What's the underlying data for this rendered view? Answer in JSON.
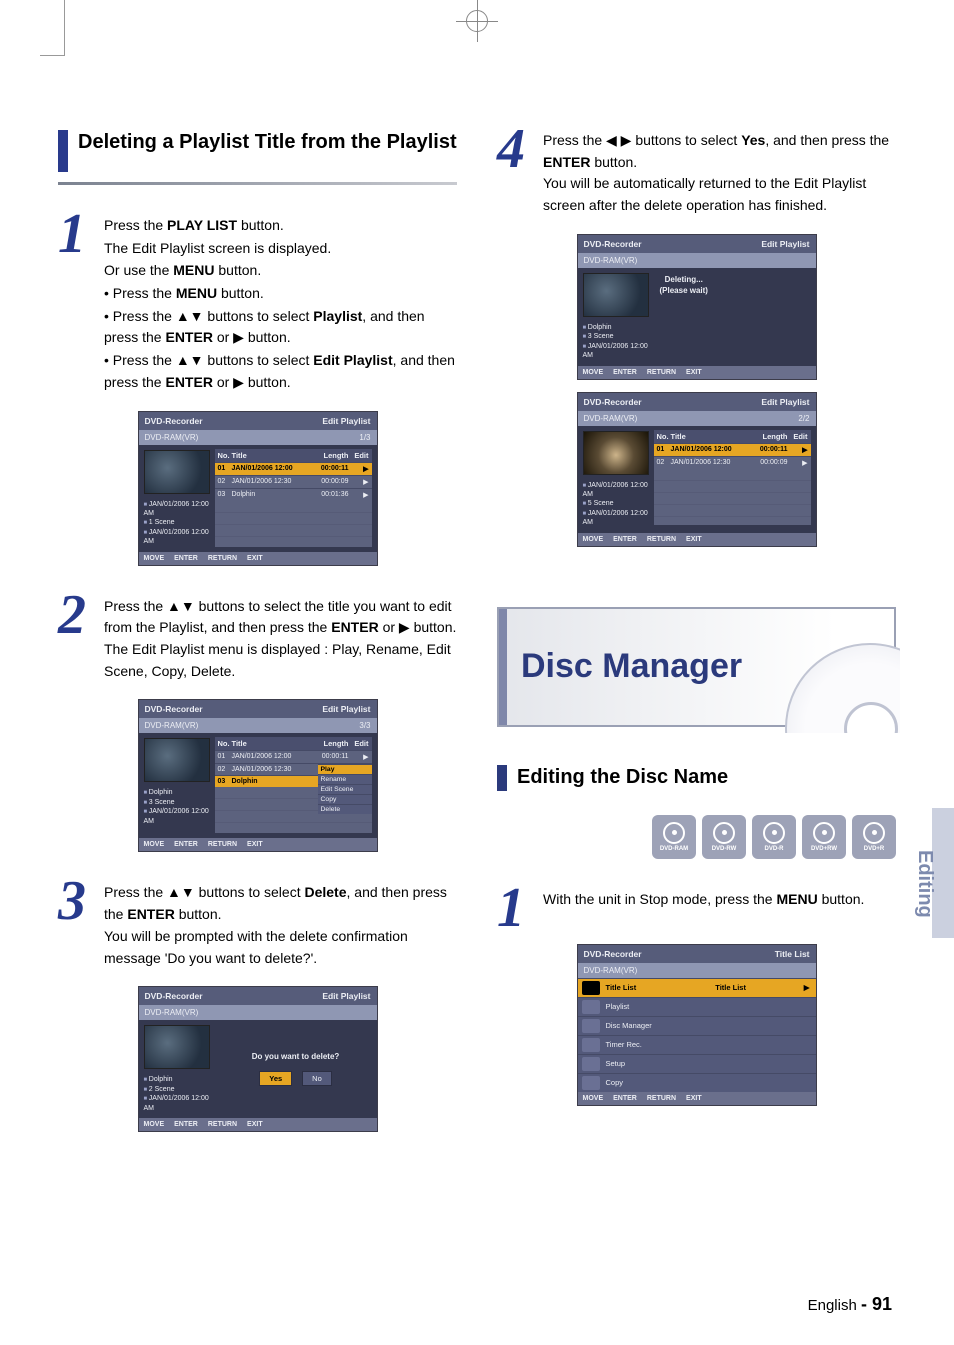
{
  "page": {
    "number_label": "- 91",
    "side_tab": "Editing"
  },
  "left": {
    "section_title": "Deleting a Playlist Title from the Playlist",
    "step1": {
      "num": "1",
      "l1a": "Press the ",
      "l1b": "PLAY LIST",
      "l1c": " button.",
      "l2": "The Edit Playlist screen is displayed.",
      "or": "Or use the ",
      "or_b": "MENU",
      "or2": " button.",
      "m1a": "• Press the ",
      "m1b": "MENU",
      "m1c": " button.",
      "m2a": "• Press the ▲▼ buttons to select ",
      "m2b": "Playlist",
      "m2c": ", and then press the ",
      "m3a": "ENTER",
      "m3b": " or ▶ button.",
      "m4a": "• Press the ▲▼ buttons to select ",
      "m4b": "Edit Playlist",
      "m4c": ", and then press the ",
      "m5a": "ENTER",
      "m5b": " or ▶ button."
    },
    "osd1": {
      "brand": "DVD-Recorder",
      "screen": "Edit Playlist",
      "disc": "DVD-RAM(VR)",
      "count": "1/3",
      "meta1": "JAN/01/2006 12:00 AM",
      "meta2": "1 Scene",
      "meta3": "JAN/01/2006 12:00 AM",
      "cols": {
        "no": "No.",
        "title": "Title",
        "len": "Length",
        "edit": "Edit"
      },
      "rows": [
        {
          "no": "01",
          "title": "JAN/01/2006 12:00",
          "len": "00:00:11",
          "edit": "▶",
          "sel": true
        },
        {
          "no": "02",
          "title": "JAN/01/2006 12:30",
          "len": "00:00:09",
          "edit": "▶",
          "sel": false
        },
        {
          "no": "03",
          "title": "Dolphin",
          "len": "00:01:36",
          "edit": "▶",
          "sel": false
        }
      ],
      "foot": {
        "move": "MOVE",
        "enter": "ENTER",
        "return": "RETURN",
        "exit": "EXIT"
      }
    },
    "step2": {
      "num": "2",
      "t1": "Press the ▲▼ buttons to select the title you want to edit from the Playlist, and then press the ",
      "t2": "ENTER",
      "t3": " or ▶ button.",
      "t4": "The Edit Playlist menu is displayed : Play, Rename, Edit Scene, Copy, Delete."
    },
    "osd2": {
      "brand": "DVD-Recorder",
      "screen": "Edit Playlist",
      "disc": "DVD-RAM(VR)",
      "count": "3/3",
      "meta1": "Dolphin",
      "meta2": "3 Scene",
      "meta3": "JAN/01/2006 12:00 AM",
      "popup": [
        "Play",
        "Rename",
        "Edit Scene",
        "Copy",
        "Delete"
      ],
      "popup_sel": 0
    },
    "step3": {
      "num": "3",
      "t1": "Press the ▲▼ buttons to select ",
      "t2": "Delete",
      "t3": ", and then press the ",
      "t4": "ENTER",
      "t5": " button.",
      "t6": "You will be prompted with the delete confirmation message 'Do you want to delete?'."
    },
    "osd3": {
      "brand": "DVD-Recorder",
      "screen": "Edit Playlist",
      "disc": "DVD-RAM(VR)",
      "meta1": "Dolphin",
      "meta2": "2 Scene",
      "meta3": "JAN/01/2006 12:00 AM",
      "msg": "Do you want to delete?",
      "yes": "Yes",
      "no": "No"
    }
  },
  "right": {
    "step4": {
      "num": "4",
      "t1": "Press the ◀ ▶ buttons to select ",
      "t2": "Yes",
      "t3": ", and then press the ",
      "t4": "ENTER",
      "t5": " button.",
      "t6": "You will be automatically returned to the Edit Playlist screen after the delete operation has finished."
    },
    "osd4a": {
      "brand": "DVD-Recorder",
      "screen": "Edit Playlist",
      "disc": "DVD-RAM(VR)",
      "meta1": "Dolphin",
      "meta2": "3 Scene",
      "meta3": "JAN/01/2006 12:00 AM",
      "msg1": "Deleting...",
      "msg2": "(Please wait)"
    },
    "osd4b": {
      "brand": "DVD-Recorder",
      "screen": "Edit Playlist",
      "disc": "DVD-RAM(VR)",
      "count": "2/2",
      "meta1": "JAN/01/2006 12:00 AM",
      "meta2": "5 Scene",
      "meta3": "JAN/01/2006 12:00 AM",
      "rows": [
        {
          "no": "01",
          "title": "JAN/01/2006 12:00",
          "len": "00:00:11",
          "edit": "▶",
          "sel": true
        },
        {
          "no": "02",
          "title": "JAN/01/2006 12:30",
          "len": "00:00:09",
          "edit": "▶",
          "sel": false
        }
      ]
    },
    "feature": "Disc Manager",
    "sub_section": "Editing the Disc Name",
    "discs": [
      "DVD-RAM",
      "DVD-RW",
      "DVD-R",
      "DVD+RW",
      "DVD+R"
    ],
    "step1r": {
      "num": "1",
      "t1": "With the unit in Stop mode, press the ",
      "t2": "MENU",
      "t3": " button."
    },
    "osdMenu": {
      "brand": "DVD-Recorder",
      "screen": "Title List",
      "disc": "DVD-RAM(VR)",
      "items": [
        {
          "label": "Title List",
          "val": "Title List",
          "arrow": "▶",
          "sel": true
        },
        {
          "label": "Playlist"
        },
        {
          "label": "Disc Manager"
        },
        {
          "label": "Timer Rec."
        },
        {
          "label": "Setup"
        },
        {
          "label": "Copy"
        }
      ]
    }
  },
  "osd_common": {
    "cols": {
      "no": "No.",
      "title": "Title",
      "len": "Length",
      "edit": "Edit"
    },
    "foot": {
      "move": "MOVE",
      "enter": "ENTER",
      "return": "RETURN",
      "exit": "EXIT"
    }
  }
}
